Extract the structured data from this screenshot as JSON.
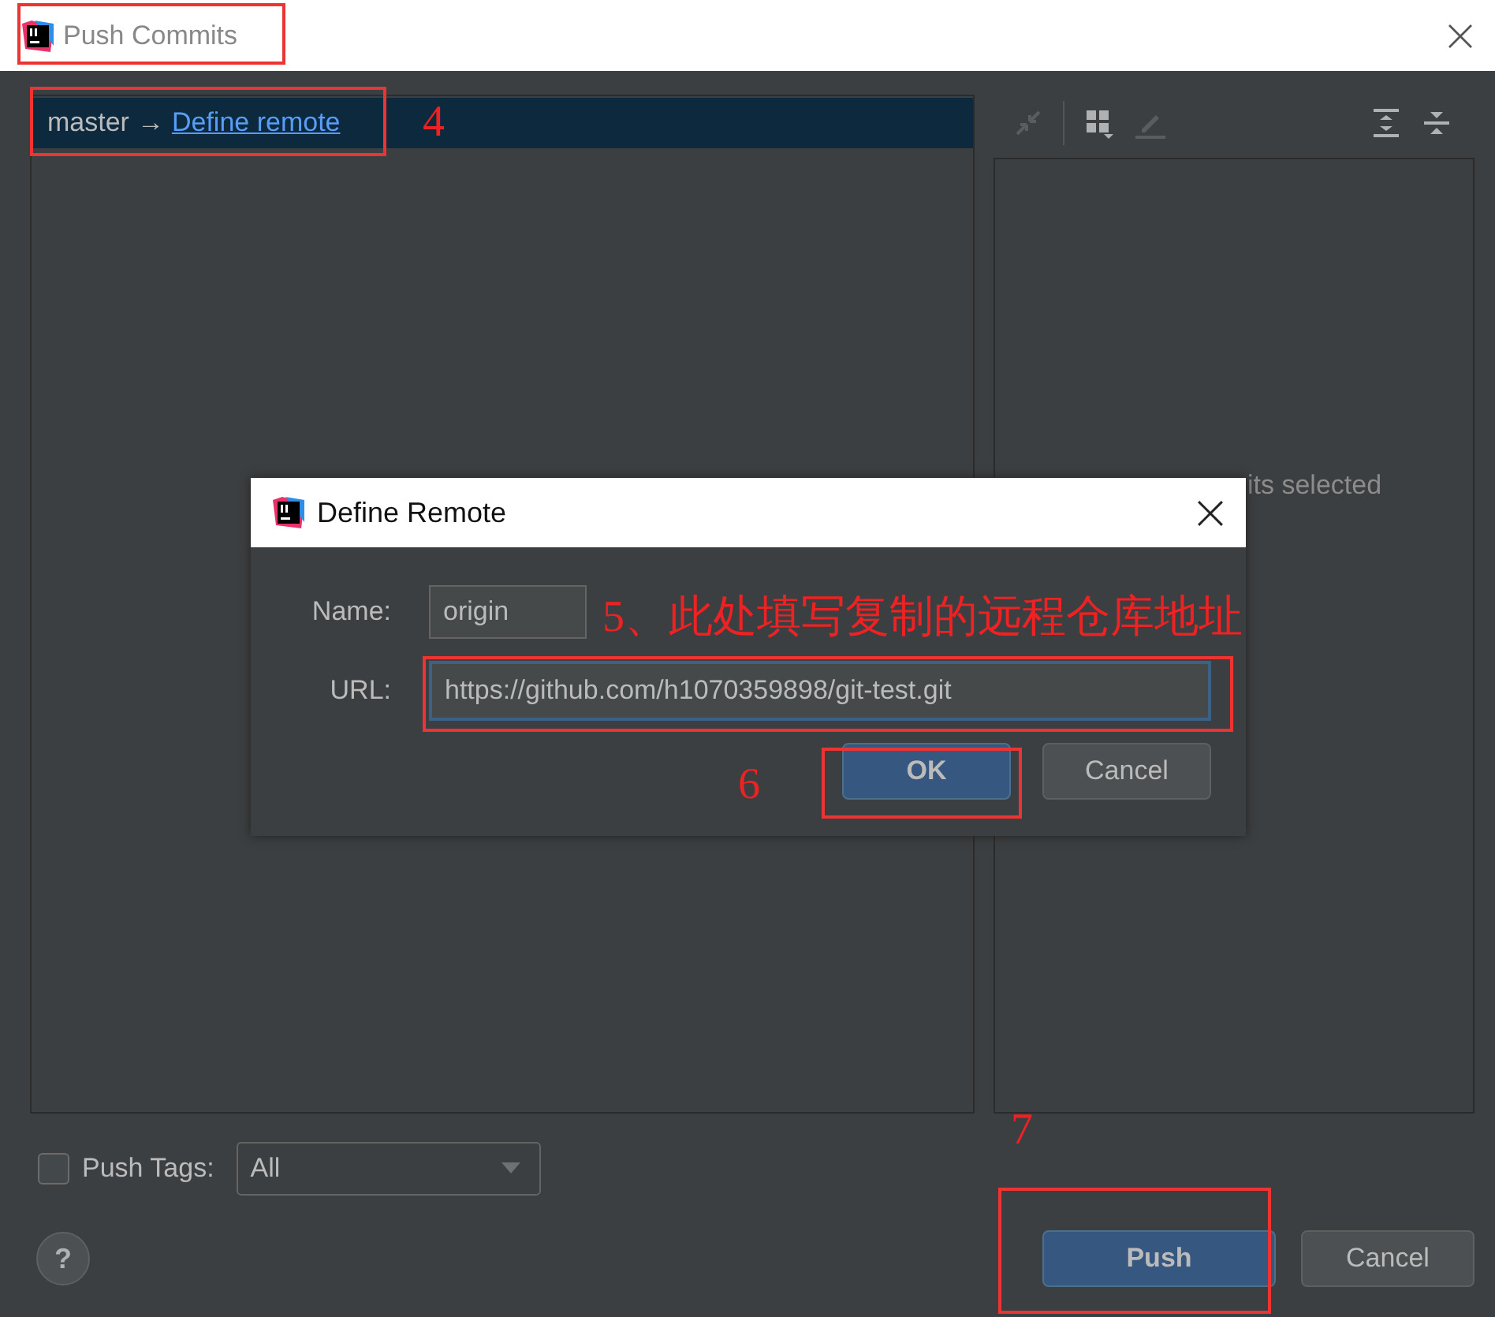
{
  "window": {
    "title": "Push Commits"
  },
  "branch_row": {
    "source": "master",
    "arrow": "→",
    "remote_link": "Define remote",
    "selected": true
  },
  "details_panel": {
    "empty_text": "its selected"
  },
  "push_tags": {
    "label": "Push Tags:",
    "checked": false,
    "value": "All"
  },
  "help_button": "?",
  "buttons": [
    {
      "label": "Push",
      "default": true
    },
    {
      "label": "Cancel",
      "default": false
    }
  ],
  "dialog": {
    "title": "Define Remote",
    "fields": [
      {
        "label": "Name:",
        "value": "origin",
        "focused": false
      },
      {
        "label": "URL:",
        "value": "https://github.com/h1070359898/git-test.git",
        "focused": true
      }
    ],
    "buttons": [
      {
        "label": "OK",
        "default": true
      },
      {
        "label": "Cancel",
        "default": false
      }
    ]
  },
  "annotations": [
    {
      "kind": "box"
    },
    {
      "kind": "box"
    },
    {
      "kind": "text",
      "text": "4"
    },
    {
      "kind": "text",
      "text": "5、此处填写复制的远程仓库地址"
    },
    {
      "kind": "box"
    },
    {
      "kind": "text",
      "text": "6"
    },
    {
      "kind": "box"
    },
    {
      "kind": "text",
      "text": "7"
    },
    {
      "kind": "box"
    }
  ]
}
